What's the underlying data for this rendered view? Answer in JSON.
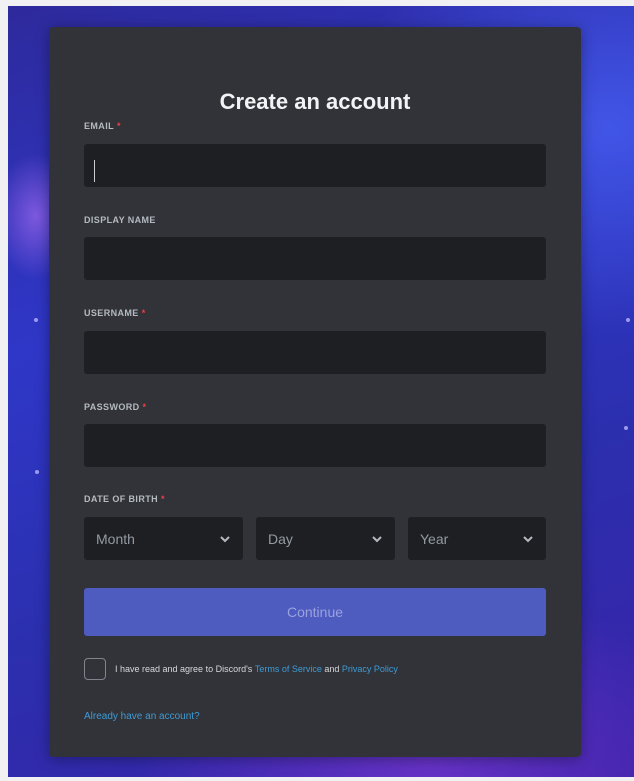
{
  "form": {
    "title": "Create an account",
    "email": {
      "label": "EMAIL",
      "required_mark": "*",
      "value": "",
      "placeholder": ""
    },
    "display_name": {
      "label": "DISPLAY NAME",
      "value": "",
      "placeholder": ""
    },
    "username": {
      "label": "USERNAME",
      "required_mark": "*",
      "value": "",
      "placeholder": ""
    },
    "password": {
      "label": "PASSWORD",
      "required_mark": "*",
      "value": "",
      "placeholder": ""
    },
    "dob": {
      "label": "DATE OF BIRTH",
      "required_mark": "*",
      "month": "Month",
      "day": "Day",
      "year": "Year"
    },
    "continue_label": "Continue",
    "agree": {
      "prefix": "I have read and agree to Discord's",
      "terms": "Terms of Service",
      "and": "and",
      "privacy": "Privacy Policy"
    },
    "login_link": "Already have an account?"
  },
  "colors": {
    "card_bg": "#313338",
    "input_bg": "#1e1f22",
    "button_bg": "#4e5bbf",
    "link": "#3e9bd6",
    "required": "#f23f42"
  },
  "icons": {
    "dropdown": "chevron-down-icon"
  }
}
